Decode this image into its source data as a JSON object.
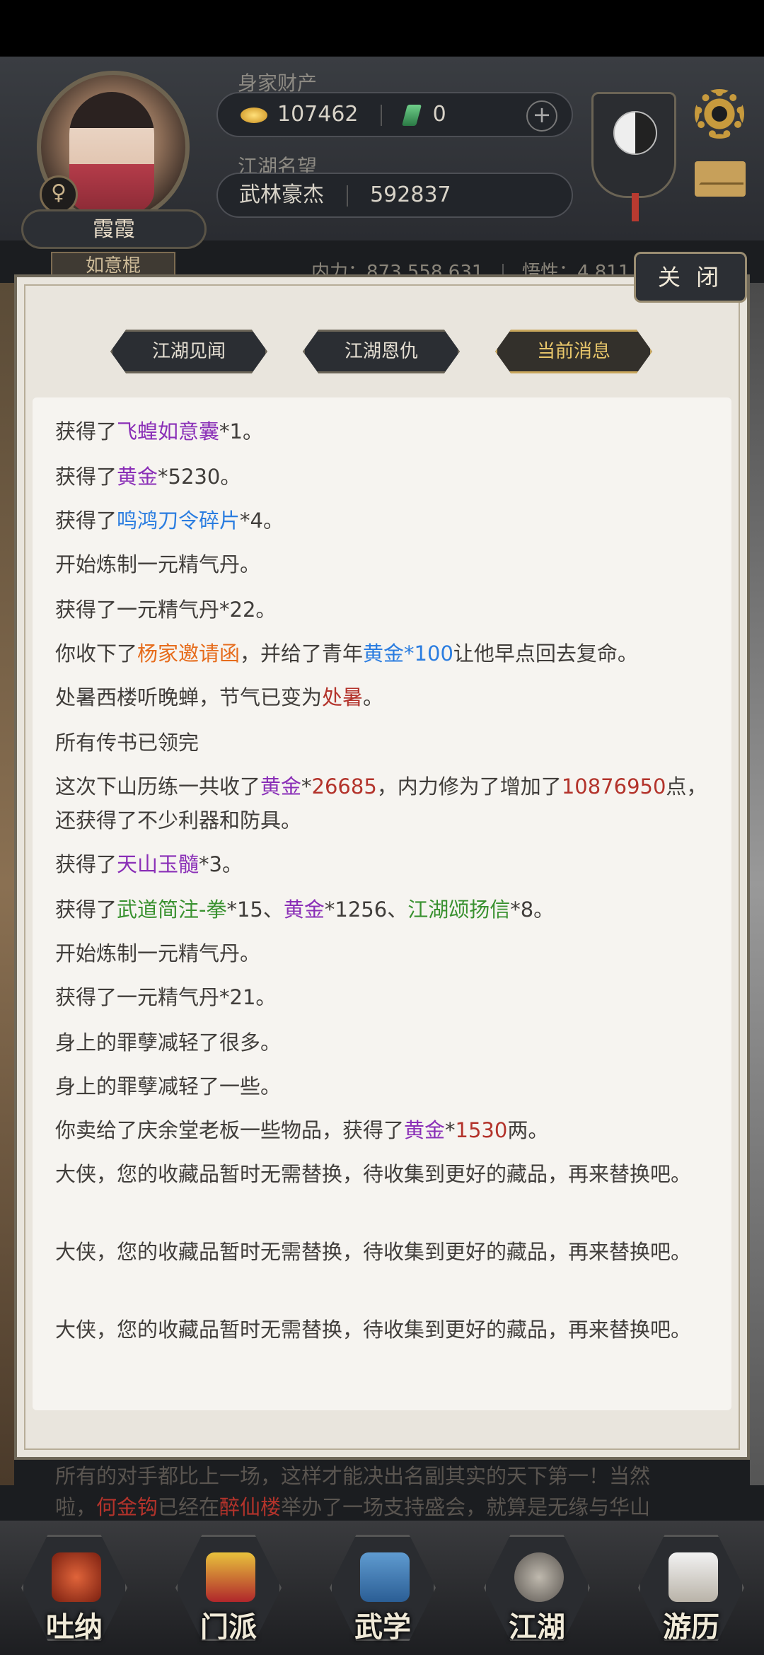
{
  "player": {
    "name": "霞霞",
    "title_tag": "如意棍",
    "gender_symbol": "♀"
  },
  "wealth": {
    "label": "身家财产",
    "gold": "107462",
    "jade": "0",
    "plus_symbol": "+"
  },
  "reputation": {
    "label": "江湖名望",
    "rank": "武林豪杰",
    "value": "592837"
  },
  "stats": {
    "neili": "内力：873,558,631",
    "wuxing": "悟性：4,811"
  },
  "dialog": {
    "close_label": "关 闭",
    "tabs": [
      {
        "label": "江湖见闻",
        "active": false
      },
      {
        "label": "江湖恩仇",
        "active": false
      },
      {
        "label": "当前消息",
        "active": true
      }
    ]
  },
  "messages": [
    {
      "id": "m1",
      "parts": [
        {
          "t": "获得了"
        },
        {
          "t": "飞蝗如意囊",
          "c": "purple"
        },
        {
          "t": "*1。"
        }
      ]
    },
    {
      "id": "m2",
      "parts": [
        {
          "t": "获得了"
        },
        {
          "t": "黄金",
          "c": "purple"
        },
        {
          "t": "*5230。"
        }
      ]
    },
    {
      "id": "m3",
      "parts": [
        {
          "t": "获得了"
        },
        {
          "t": "鸣鸿刀令碎片",
          "c": "blue"
        },
        {
          "t": "*4。"
        }
      ]
    },
    {
      "id": "m4",
      "parts": [
        {
          "t": "开始炼制一元精气丹。"
        }
      ]
    },
    {
      "id": "m5",
      "parts": [
        {
          "t": "获得了一元精气丹*22。"
        }
      ]
    },
    {
      "id": "m6",
      "parts": [
        {
          "t": "你收下了"
        },
        {
          "t": "杨家邀请函",
          "c": "orange"
        },
        {
          "t": "，并给了青年"
        },
        {
          "t": "黄金*100",
          "c": "blue"
        },
        {
          "t": "让他早点回去复命。"
        }
      ]
    },
    {
      "id": "m7",
      "parts": [
        {
          "t": "处暑西楼听晚蝉，节气已变为"
        },
        {
          "t": "处暑",
          "c": "red"
        },
        {
          "t": "。"
        }
      ]
    },
    {
      "id": "m8",
      "parts": [
        {
          "t": "所有传书已领完"
        }
      ]
    },
    {
      "id": "m9",
      "parts": [
        {
          "t": "这次下山历练一共收了"
        },
        {
          "t": "黄金",
          "c": "purple"
        },
        {
          "t": "*"
        },
        {
          "t": "26685",
          "c": "red"
        },
        {
          "t": "，内力修为了增加了"
        },
        {
          "t": "10876950",
          "c": "red"
        },
        {
          "t": "点，还获得了不少利器和防具。"
        }
      ]
    },
    {
      "id": "m10",
      "parts": [
        {
          "t": "获得了"
        },
        {
          "t": "天山玉髓",
          "c": "purple"
        },
        {
          "t": "*3。"
        }
      ]
    },
    {
      "id": "m11",
      "parts": [
        {
          "t": "获得了"
        },
        {
          "t": "武道简注-拳",
          "c": "green"
        },
        {
          "t": "*15、"
        },
        {
          "t": "黄金",
          "c": "purple"
        },
        {
          "t": "*1256、"
        },
        {
          "t": "江湖颂扬信",
          "c": "green"
        },
        {
          "t": "*8。"
        }
      ]
    },
    {
      "id": "m12",
      "parts": [
        {
          "t": "开始炼制一元精气丹。"
        }
      ]
    },
    {
      "id": "m13",
      "parts": [
        {
          "t": "获得了一元精气丹*21。"
        }
      ]
    },
    {
      "id": "m14",
      "parts": [
        {
          "t": "身上的罪孽减轻了很多。"
        }
      ]
    },
    {
      "id": "m15",
      "parts": [
        {
          "t": "身上的罪孽减轻了一些。"
        }
      ]
    },
    {
      "id": "m16",
      "parts": [
        {
          "t": "你卖给了庆余堂老板一些物品，获得了"
        },
        {
          "t": "黄金",
          "c": "purple"
        },
        {
          "t": "*"
        },
        {
          "t": "1530",
          "c": "red"
        },
        {
          "t": "两。"
        }
      ]
    },
    {
      "id": "m17",
      "parts": [
        {
          "t": "大侠，您的收藏品暂时无需替换，待收集到更好的藏品，再来替换吧。"
        }
      ]
    },
    {
      "id": "m18",
      "parts": [
        {
          "t": "大侠，您的收藏品暂时无需替换，待收集到更好的藏品，再来替换吧。"
        }
      ]
    },
    {
      "id": "m19",
      "parts": [
        {
          "t": "大侠，您的收藏品暂时无需替换，待收集到更好的藏品，再来替换吧。"
        }
      ]
    }
  ],
  "background_text": {
    "line1": "所有的对手都比上一场，这样才能决出名副其实的天下第一！当然",
    "line2_a": "啦，",
    "line2_name": "何金钩",
    "line2_b": "已经在",
    "line2_place": "醉仙楼",
    "line2_c": "举办了一场支持盛会，就算是无缘与华山"
  },
  "bottom_nav": [
    {
      "label": "吐纳",
      "icon": "rooster-icon"
    },
    {
      "label": "门派",
      "icon": "banner-icon"
    },
    {
      "label": "武学",
      "icon": "scroll-book-icon"
    },
    {
      "label": "江湖",
      "icon": "bamboo-hat-icon"
    },
    {
      "label": "游历",
      "icon": "horse-icon"
    }
  ],
  "colors": {
    "purple": "#8a2fb7",
    "blue": "#2b7de0",
    "orange": "#e66c1c",
    "red": "#b3332b",
    "green": "#39912f",
    "tab_active": "#e9c76b"
  }
}
